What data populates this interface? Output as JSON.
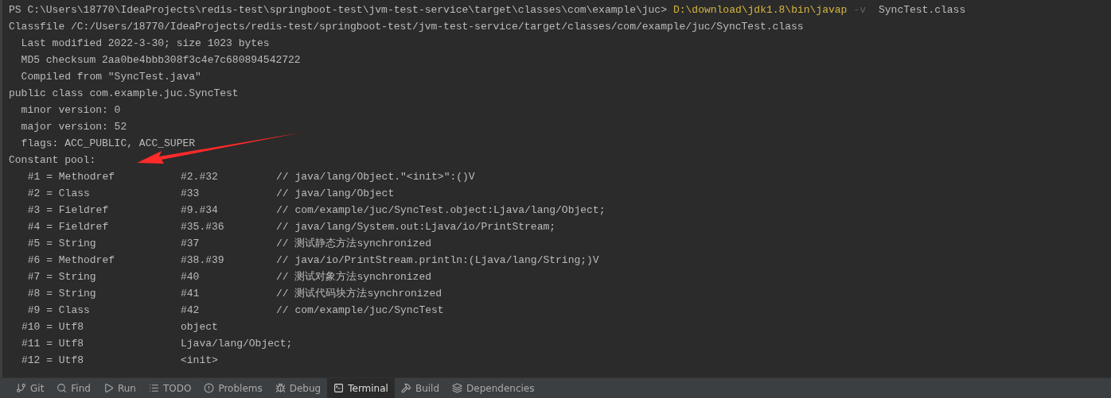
{
  "prompt": {
    "path": "PS C:\\Users\\18770\\IdeaProjects\\redis-test\\springboot-test\\jvm-test-service\\target\\classes\\com\\example\\juc>",
    "command": "D:\\download\\jdk1.8\\bin\\javap",
    "option": "-v",
    "argument": "SyncTest.class"
  },
  "output_lines": [
    {
      "kind": "text",
      "text": "Classfile /C:/Users/18770/IdeaProjects/redis-test/springboot-test/jvm-test-service/target/classes/com/example/juc/SyncTest.class"
    },
    {
      "kind": "text",
      "text": "  Last modified 2022-3-30; size 1023 bytes"
    },
    {
      "kind": "text",
      "text": "  MD5 checksum 2aa0be4bbb308f3c4e7c680894542722"
    },
    {
      "kind": "text",
      "text": "  Compiled from \"SyncTest.java\""
    },
    {
      "kind": "text",
      "text": "public class com.example.juc.SyncTest"
    },
    {
      "kind": "text",
      "text": "  minor version: 0"
    },
    {
      "kind": "text",
      "text": "  major version: 52"
    },
    {
      "kind": "text",
      "text": "  flags: ACC_PUBLIC, ACC_SUPER"
    },
    {
      "kind": "text",
      "text": "Constant pool:"
    },
    {
      "kind": "entry",
      "index": " #1 = Methodref",
      "ref": "#2.#32",
      "comment": "// java/lang/Object.\"<init>\":()V"
    },
    {
      "kind": "entry",
      "index": " #2 = Class",
      "ref": "#33",
      "comment": "// java/lang/Object"
    },
    {
      "kind": "entry",
      "index": " #3 = Fieldref",
      "ref": "#9.#34",
      "comment": "// com/example/juc/SyncTest.object:Ljava/lang/Object;"
    },
    {
      "kind": "entry",
      "index": " #4 = Fieldref",
      "ref": "#35.#36",
      "comment": "// java/lang/System.out:Ljava/io/PrintStream;"
    },
    {
      "kind": "entry",
      "index": " #5 = String",
      "ref": "#37",
      "comment": "// 测试静态方法synchronized"
    },
    {
      "kind": "entry",
      "index": " #6 = Methodref",
      "ref": "#38.#39",
      "comment": "// java/io/PrintStream.println:(Ljava/lang/String;)V"
    },
    {
      "kind": "entry",
      "index": " #7 = String",
      "ref": "#40",
      "comment": "// 测试对象方法synchronized"
    },
    {
      "kind": "entry",
      "index": " #8 = String",
      "ref": "#41",
      "comment": "// 测试代码块方法synchronized"
    },
    {
      "kind": "entry",
      "index": " #9 = Class",
      "ref": "#42",
      "comment": "// com/example/juc/SyncTest"
    },
    {
      "kind": "entry",
      "index": "#10 = Utf8",
      "ref": "object"
    },
    {
      "kind": "entry",
      "index": "#11 = Utf8",
      "ref": "Ljava/lang/Object;"
    },
    {
      "kind": "entry",
      "index": "#12 = Utf8",
      "ref": "<init>"
    }
  ],
  "tool_tabs": [
    {
      "kind": "git",
      "label": "Git",
      "selected": false
    },
    {
      "kind": "find",
      "label": "Find",
      "selected": false
    },
    {
      "kind": "run",
      "label": "Run",
      "selected": false
    },
    {
      "kind": "todo",
      "label": "TODO",
      "selected": false
    },
    {
      "kind": "problems",
      "label": "Problems",
      "selected": false
    },
    {
      "kind": "debug",
      "label": "Debug",
      "selected": false
    },
    {
      "kind": "terminal",
      "label": "Terminal",
      "selected": true
    },
    {
      "kind": "build",
      "label": "Build",
      "selected": false
    },
    {
      "kind": "dependencies",
      "label": "Dependencies",
      "selected": false
    }
  ]
}
